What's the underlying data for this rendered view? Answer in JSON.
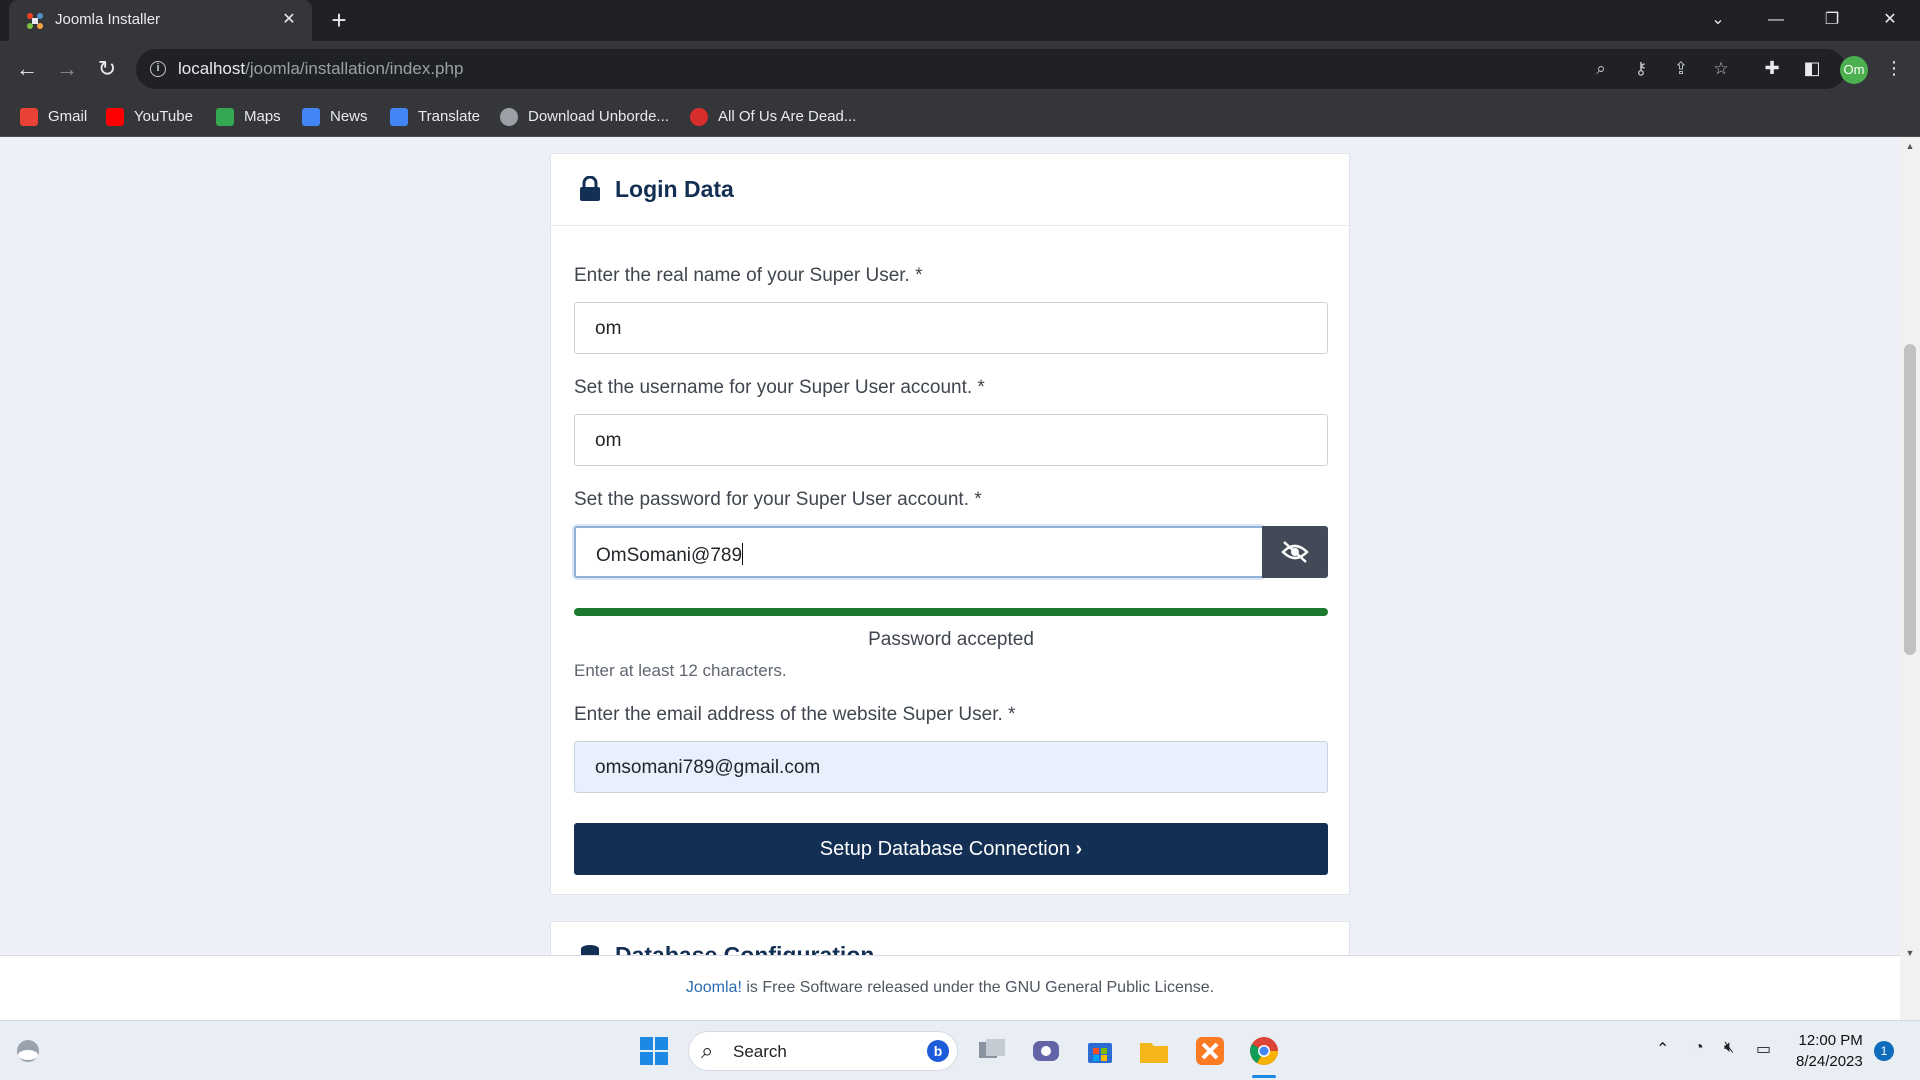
{
  "browser": {
    "tab_title": "Joomla Installer",
    "url_host": "localhost",
    "url_path": "/joomla/installation/index.php",
    "profile_initials": "Om",
    "bookmarks": [
      {
        "label": "Gmail",
        "icon": "gmail-icon",
        "color": "#ea4335"
      },
      {
        "label": "YouTube",
        "icon": "youtube-icon",
        "color": "#ff0000"
      },
      {
        "label": "Maps",
        "icon": "maps-icon",
        "color": "#34a853"
      },
      {
        "label": "News",
        "icon": "news-icon",
        "color": "#4285f4"
      },
      {
        "label": "Translate",
        "icon": "translate-icon",
        "color": "#4285f4"
      },
      {
        "label": "Download Unborde...",
        "icon": "globe-icon",
        "color": "#9aa0a6"
      },
      {
        "label": "All Of Us Are Dead...",
        "icon": "vivaldi-icon",
        "color": "#d62d2d"
      }
    ]
  },
  "login": {
    "section_title": "Login Data",
    "realname_label": "Enter the real name of your Super User. *",
    "realname_value": "om",
    "username_label": "Set the username for your Super User account. *",
    "username_value": "om",
    "password_label": "Set the password for your Super User account. *",
    "password_value": "OmSomani@789",
    "strength_percent": 100,
    "strength_text": "Password accepted",
    "password_hint": "Enter at least 12 characters.",
    "email_label": "Enter the email address of the website Super User. *",
    "email_value": "omsomani789@gmail.com",
    "submit_label": "Setup Database Connection"
  },
  "next_section": {
    "title": "Database Configuration"
  },
  "footer": {
    "link": "Joomla!",
    "text": " is Free Software released under the GNU General Public License."
  },
  "taskbar": {
    "search_label": "Search",
    "time": "12:00 PM",
    "date": "8/24/2023",
    "notification_count": "1"
  },
  "colors": {
    "accent": "#132f53",
    "success": "#1b7a2f"
  }
}
